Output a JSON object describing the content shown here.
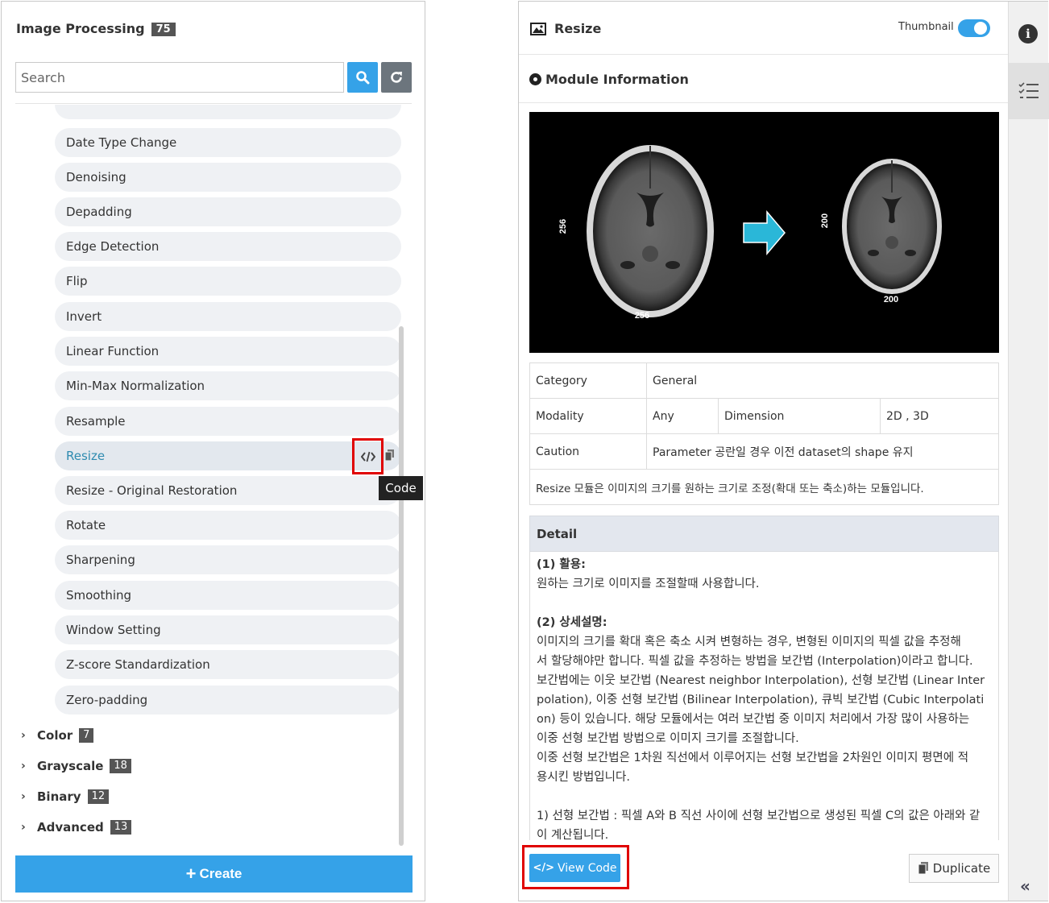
{
  "left_panel": {
    "title": "Image Processing",
    "count": "75",
    "search_placeholder": "Search",
    "items": [
      {
        "label": "Date Type Change"
      },
      {
        "label": "Denoising"
      },
      {
        "label": "Depadding"
      },
      {
        "label": "Edge Detection"
      },
      {
        "label": "Flip"
      },
      {
        "label": "Invert"
      },
      {
        "label": "Linear Function"
      },
      {
        "label": "Min-Max Normalization"
      },
      {
        "label": "Resample"
      },
      {
        "label": "Resize"
      },
      {
        "label": "Resize - Original Restoration"
      },
      {
        "label": "Rotate"
      },
      {
        "label": "Sharpening"
      },
      {
        "label": "Smoothing"
      },
      {
        "label": "Window Setting"
      },
      {
        "label": "Z-score Standardization"
      },
      {
        "label": "Zero-padding"
      }
    ],
    "active_item": "Resize",
    "tooltip": "Code",
    "groups": [
      {
        "label": "Color",
        "count": "7"
      },
      {
        "label": "Grayscale",
        "count": "18"
      },
      {
        "label": "Binary",
        "count": "12"
      },
      {
        "label": "Advanced",
        "count": "13"
      }
    ],
    "create_label": "Create"
  },
  "right_panel": {
    "title": "Resize",
    "thumbnail_label": "Thumbnail",
    "thumbnail_on": true,
    "section_title": "Module Information",
    "image": {
      "left_width": "256",
      "left_height": "256",
      "right_width": "200",
      "right_height": "200"
    },
    "info": {
      "category_label": "Category",
      "category_value": "General",
      "modality_label": "Modality",
      "modality_value": "Any",
      "dimension_label": "Dimension",
      "dimension_value": "2D , 3D",
      "caution_label": "Caution",
      "caution_value": "Parameter 공란일 경우 이전 dataset의 shape 유지",
      "description": "Resize 모듈은 이미지의 크기를 원하는 크기로 조정(확대 또는 축소)하는 모듈입니다."
    },
    "detail": {
      "header": "Detail",
      "usage_title": "(1) 활용:",
      "usage_text": "원하는 크기로 이미지를 조절할때 사용합니다.",
      "desc_title": "(2) 상세설명:",
      "desc_lines": [
        "이미지의 크기를 확대 혹은 축소 시켜 변형하는 경우, 변형된 이미지의 픽셀 값을 추정해",
        "서 할당해야만 합니다. 픽셀 값을 추정하는 방법을 보간법 (Interpolation)이라고 합니다.",
        "보간법에는 이웃 보간법 (Nearest neighbor Interpolation), 선형 보간법 (Linear Inter",
        "polation), 이중 선형 보간법 (Bilinear Interpolation), 큐빅 보간법 (Cubic Interpolati",
        "on) 등이 있습니다. 해당 모듈에서는 여러 보간법 중 이미지 처리에서 가장 많이 사용하는",
        "이중 선형 보간법 방법으로 이미지 크기를 조절합니다.",
        "이중 선형 보간법은 1차원 직선에서 이루어지는 선형 보간법을 2차원인 이미지 평면에 적",
        "용시킨 방법입니다."
      ],
      "linear_lines": [
        "1) 선형 보간법 : 픽셀 A와 B 직선 사이에 선형 보간법으로 생성된 픽셀 C의 값은 아래와 같",
        "이 계산됩니다."
      ]
    },
    "view_code_label": "View Code",
    "duplicate_label": "Duplicate"
  },
  "colors": {
    "accent": "#35a2e8",
    "caution": "#e03030",
    "highlight_frame": "#e00000"
  }
}
